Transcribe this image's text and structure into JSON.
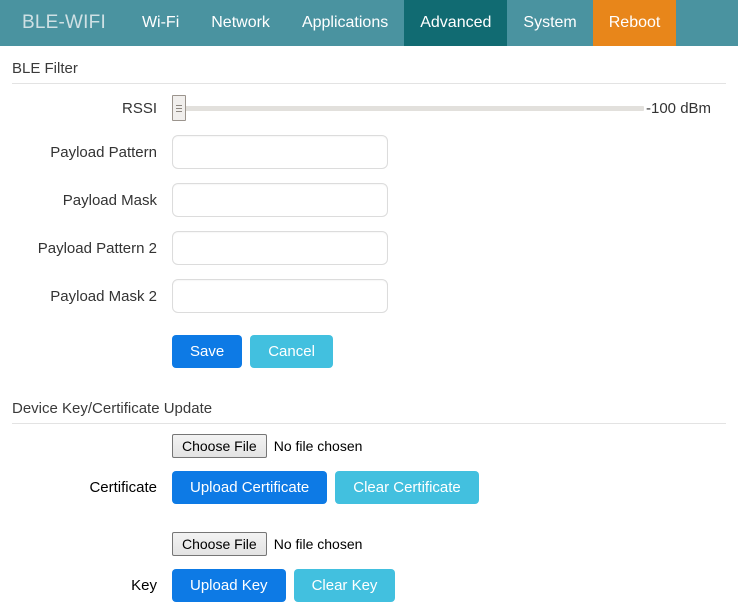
{
  "navbar": {
    "brand": "BLE-WIFI",
    "items": [
      {
        "label": "Wi-Fi",
        "state": "normal"
      },
      {
        "label": "Network",
        "state": "normal"
      },
      {
        "label": "Applications",
        "state": "normal"
      },
      {
        "label": "Advanced",
        "state": "active"
      },
      {
        "label": "System",
        "state": "normal"
      },
      {
        "label": "Reboot",
        "state": "reboot"
      }
    ],
    "colors": {
      "background": "#4a93a0",
      "active": "#116b72",
      "reboot": "#e8861a",
      "brand_text": "#cfe0e4",
      "item_text": "#ffffff"
    }
  },
  "ble_filter": {
    "legend": "BLE Filter",
    "rssi": {
      "label": "RSSI",
      "value_text": "-100 dBm",
      "slider_position_percent": 0
    },
    "fields": [
      {
        "label": "Payload Pattern",
        "value": "",
        "placeholder": ""
      },
      {
        "label": "Payload Mask",
        "value": "",
        "placeholder": ""
      },
      {
        "label": "Payload Pattern 2",
        "value": "",
        "placeholder": ""
      },
      {
        "label": "Payload Mask 2",
        "value": "",
        "placeholder": ""
      }
    ],
    "buttons": {
      "save": "Save",
      "cancel": "Cancel"
    }
  },
  "device_update": {
    "legend": "Device Key/Certificate Update",
    "certificate": {
      "choose_file_label": "Choose File",
      "file_status": "No file chosen",
      "row_label": "Certificate",
      "upload_label": "Upload Certificate",
      "clear_label": "Clear Certificate"
    },
    "key": {
      "choose_file_label": "Choose File",
      "file_status": "No file chosen",
      "row_label": "Key",
      "upload_label": "Upload Key",
      "clear_label": "Clear Key"
    }
  },
  "colors": {
    "primary_button": "#0d7ae5",
    "secondary_button": "#42c0df",
    "divider": "#e3e3e3",
    "slider_track": "#e2e0dc"
  }
}
